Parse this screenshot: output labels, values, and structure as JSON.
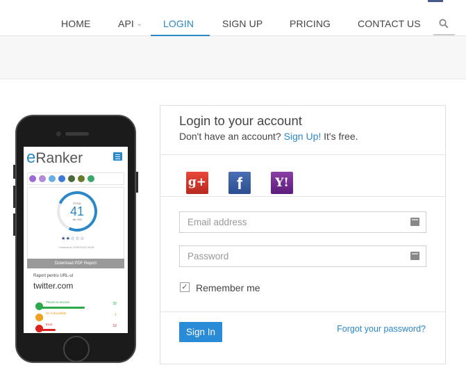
{
  "nav": {
    "items": [
      {
        "label": "HOME"
      },
      {
        "label": "API"
      },
      {
        "label": "LOGIN"
      },
      {
        "label": "SIGN UP"
      },
      {
        "label": "PRICING"
      },
      {
        "label": "CONTACT US"
      }
    ],
    "active": "LOGIN",
    "api_caret": "⌄",
    "search_icon": "search-icon"
  },
  "phone_screen": {
    "logo_e": "e",
    "logo_rest": "Ranker",
    "score_total_label": "TOTAL",
    "score": "41",
    "score_max": "din 100",
    "stars": "★★☆☆☆",
    "generated": "Generat la 22/05/2016 08:08",
    "pdf_button": "Download PDF Report",
    "report_label": "Raport pentru URL-ul",
    "report_url": "twitter.com",
    "bars": [
      {
        "label": "Trecut cu succes",
        "value": "32",
        "color": "#2aa84a"
      },
      {
        "label": "De îmbunătățit",
        "value": "1",
        "color": "#f0a020"
      },
      {
        "label": "Erori",
        "value": "12",
        "color": "#d9231c"
      }
    ]
  },
  "login": {
    "title": "Login to your account",
    "sub_prefix": "Don't have an account?",
    "sub_link": "Sign Up!",
    "sub_suffix": "It's free.",
    "social": {
      "google_label": "g+",
      "facebook_label": "f",
      "yahoo_label": "Y!"
    },
    "email_placeholder": "Email address",
    "password_placeholder": "Password",
    "remember_label": "Remember me",
    "remember_checked": "✓",
    "signin_label": "Sign In",
    "forgot_label": "Forgot your password?"
  },
  "colors": {
    "accent": "#2a88c8",
    "signin_button": "#2a8bd6"
  }
}
